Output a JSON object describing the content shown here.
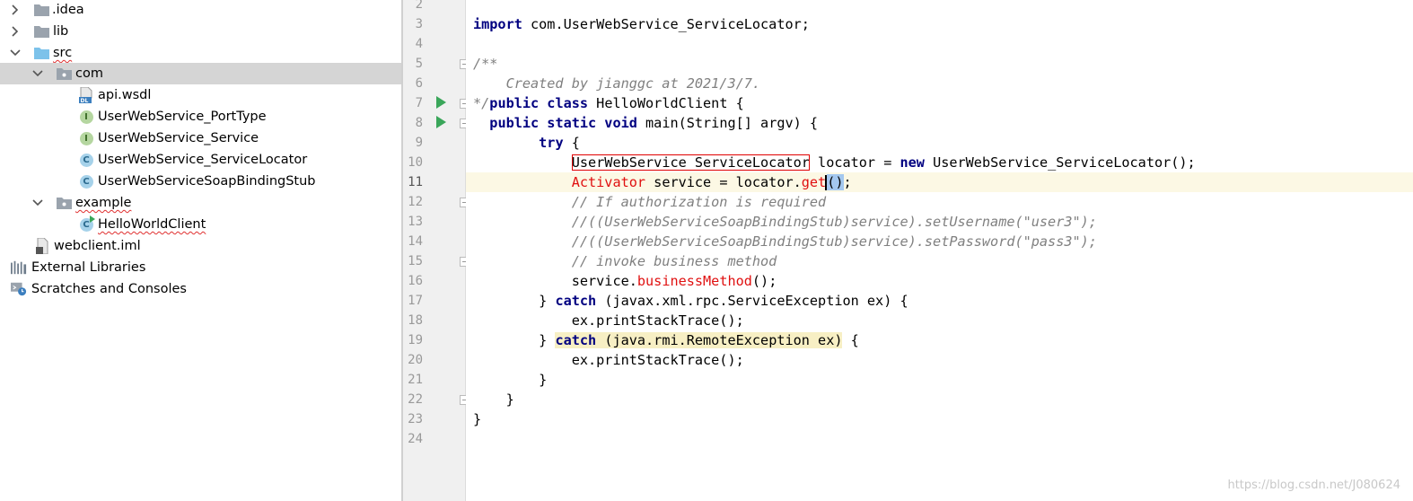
{
  "tree": {
    "items": [
      {
        "label": "idea",
        "name": "tree-item-idea"
      },
      {
        "label": "lib",
        "name": "tree-item-lib"
      },
      {
        "label": "src",
        "name": "tree-item-src"
      },
      {
        "label": "com",
        "name": "tree-item-com"
      },
      {
        "label": "api.wsdl",
        "name": "tree-item-api-wsdl"
      },
      {
        "label": "UserWebService_PortType",
        "name": "tree-item-portype"
      },
      {
        "label": "UserWebService_Service",
        "name": "tree-item-service"
      },
      {
        "label": "UserWebService_ServiceLocator",
        "name": "tree-item-servicelocator"
      },
      {
        "label": "UserWebServiceSoapBindingStub",
        "name": "tree-item-stub"
      },
      {
        "label": "example",
        "name": "tree-item-example"
      },
      {
        "label": "HelloWorldClient",
        "name": "tree-item-helloworldclient"
      },
      {
        "label": "webclient.iml",
        "name": "tree-item-webclient-iml"
      },
      {
        "label": "External Libraries",
        "name": "tree-item-external-libraries"
      },
      {
        "label": "Scratches and Consoles",
        "name": "tree-item-scratches"
      }
    ],
    "idea_prefix": "."
  },
  "gutter": {
    "line_numbers": [
      "2",
      "3",
      "4",
      "5",
      "6",
      "7",
      "8",
      "9",
      "10",
      "11",
      "12",
      "13",
      "14",
      "15",
      "16",
      "17",
      "18",
      "19",
      "20",
      "21",
      "22",
      "23",
      "24"
    ]
  },
  "code": {
    "l3_kw": "import",
    "l3_rest": " com.UserWebService_ServiceLocator;",
    "l5": "/**",
    "l6": "    Created by jianggc at 2021/3/7.",
    "l7_cmt": "*/",
    "l7_kw": "public class",
    "l7_rest": " HelloWorldClient {",
    "l8_indent": "  ",
    "l8_kw": "public static void",
    "l8_rest": " main(String[] argv) {",
    "l9_indent": "        ",
    "l9_kw": "try",
    "l9_rest": " {",
    "l10_indent": "            ",
    "l10_type": "UserWebService_ServiceLocator",
    "l10_mid": " locator = ",
    "l10_kw": "new",
    "l10_rest": " UserWebService_ServiceLocator();",
    "l11_indent": "            ",
    "l11_type": "Activator",
    "l11_mid": " service = locator.",
    "l11_method": "get",
    "l11_parens": "()",
    "l11_end": ";",
    "l12": "            // If authorization is required",
    "l13": "            //((UserWebServiceSoapBindingStub)service).setUsername(\"user3\");",
    "l14": "            //((UserWebServiceSoapBindingStub)service).setPassword(\"pass3\");",
    "l15": "            // invoke business method",
    "l16_indent": "            ",
    "l16_pre": "service.",
    "l16_method": "businessMethod",
    "l16_end": "();",
    "l17_indent": "        ",
    "l17_pre": "} ",
    "l17_kw": "catch",
    "l17_rest": " (javax.xml.rpc.ServiceException ex) {",
    "l18": "            ex.printStackTrace();",
    "l19_indent": "        ",
    "l19_pre": "} ",
    "l19_kw": "catch",
    "l19_hl": " (java.rmi.RemoteException ex)",
    "l19_rest": " {",
    "l20": "            ex.printStackTrace();",
    "l21": "        }",
    "l22": "    }",
    "l23": "}"
  },
  "watermark": "https://blog.csdn.net/J080624",
  "colors": {
    "keyword": "#000080",
    "comment": "#808080",
    "error": "#e01010",
    "selected_row": "#d5d5d5",
    "caret_line": "#fcf8e4"
  }
}
